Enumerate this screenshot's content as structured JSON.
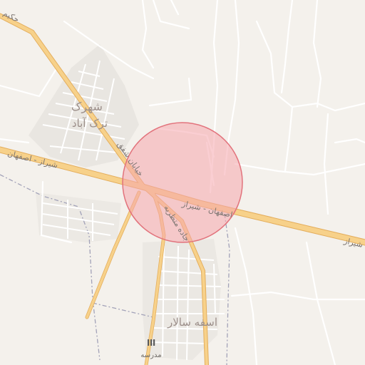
{
  "map": {
    "colors": {
      "land": "#f4f1ec",
      "built_up": "#e9e6e1",
      "minor_road": "#ffffff",
      "major_road": "#f7d18a",
      "major_road_casing": "#e4ae5d",
      "boundary": "#a2a2b8",
      "highlight_fill": "#f6a6ad",
      "highlight_stroke": "#e2737c",
      "label_text": "#7b7470",
      "place_label_text": "#9c8f8a"
    },
    "highlight_circle": {
      "shape": "circle",
      "description": "selected area"
    },
    "labels": {
      "top_left_road": "حکیم",
      "place_north": "شهرک",
      "place_north_2": "ترک آباد",
      "road_west": "شیراز - اصفهان",
      "road_center": "اصفهان - شیراز",
      "road_east": "شیراز",
      "road_diagonal": "خیابان شفق",
      "road_south": "جاده متظریه",
      "town_south": "اسفه سالار",
      "poi_school": "مدرسه"
    },
    "poi_icons": {
      "school": "school-icon"
    }
  }
}
